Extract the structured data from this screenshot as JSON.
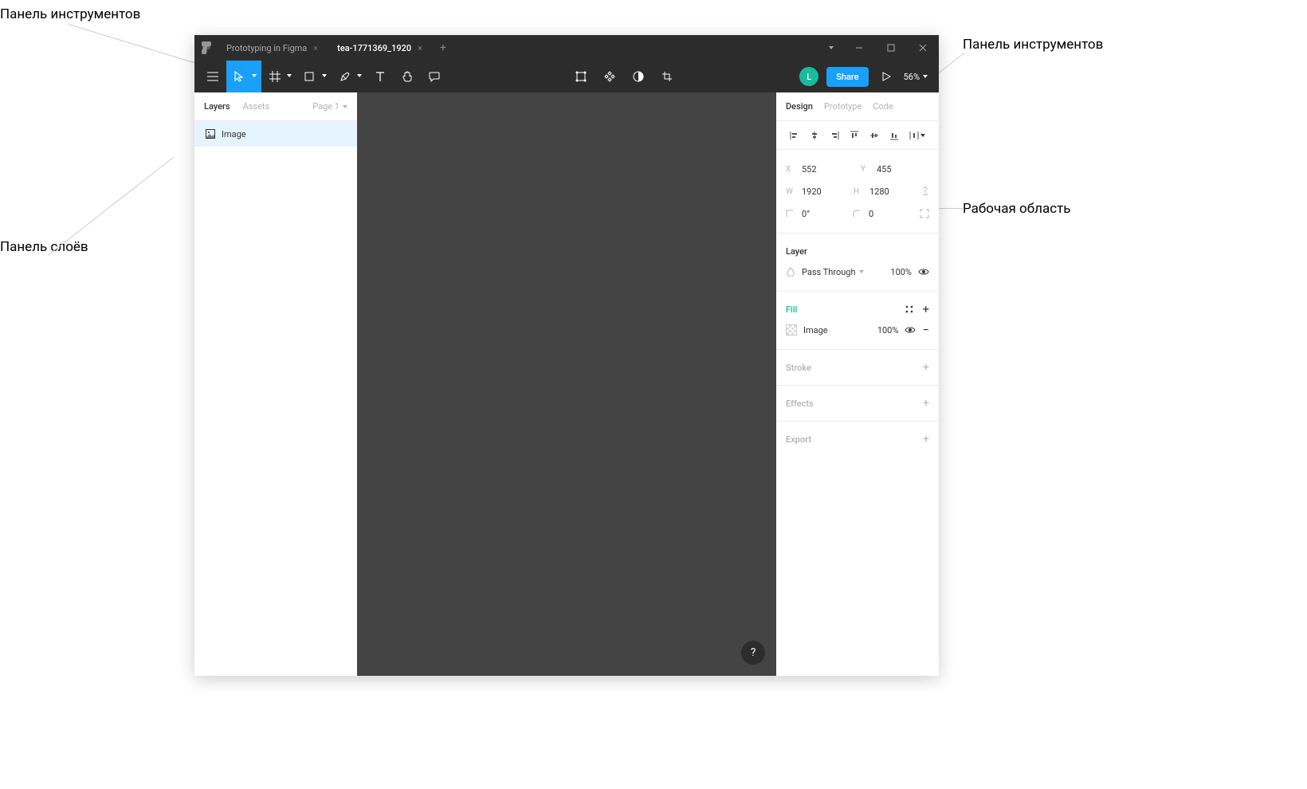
{
  "annotations": {
    "top_left": "Панель инструментов",
    "top_right": "Панель инструментов",
    "layers": "Панель слоёв",
    "workspace": "Рабочая область"
  },
  "titlebar": {
    "tab1": "Prototyping in Figma",
    "tab2": "tea-1771369_1920"
  },
  "toolbar": {
    "avatar": "L",
    "share": "Share",
    "zoom": "56%"
  },
  "left_panel": {
    "tab_layers": "Layers",
    "tab_assets": "Assets",
    "page": "Page 1",
    "layer_name": "Image"
  },
  "right_panel": {
    "tab_design": "Design",
    "tab_prototype": "Prototype",
    "tab_code": "Code",
    "pos": {
      "x_label": "X",
      "x": "552",
      "y_label": "Y",
      "y": "455"
    },
    "size": {
      "w_label": "W",
      "w": "1920",
      "h_label": "H",
      "h": "1280"
    },
    "rot": {
      "label": "",
      "val": "0°",
      "corner_label": "",
      "corner": "0"
    },
    "layer_title": "Layer",
    "blend": "Pass Through",
    "opacity": "100%",
    "fill_title": "Fill",
    "fill_type": "Image",
    "fill_opacity": "100%",
    "stroke_title": "Stroke",
    "effects_title": "Effects",
    "export_title": "Export"
  },
  "help": "?"
}
